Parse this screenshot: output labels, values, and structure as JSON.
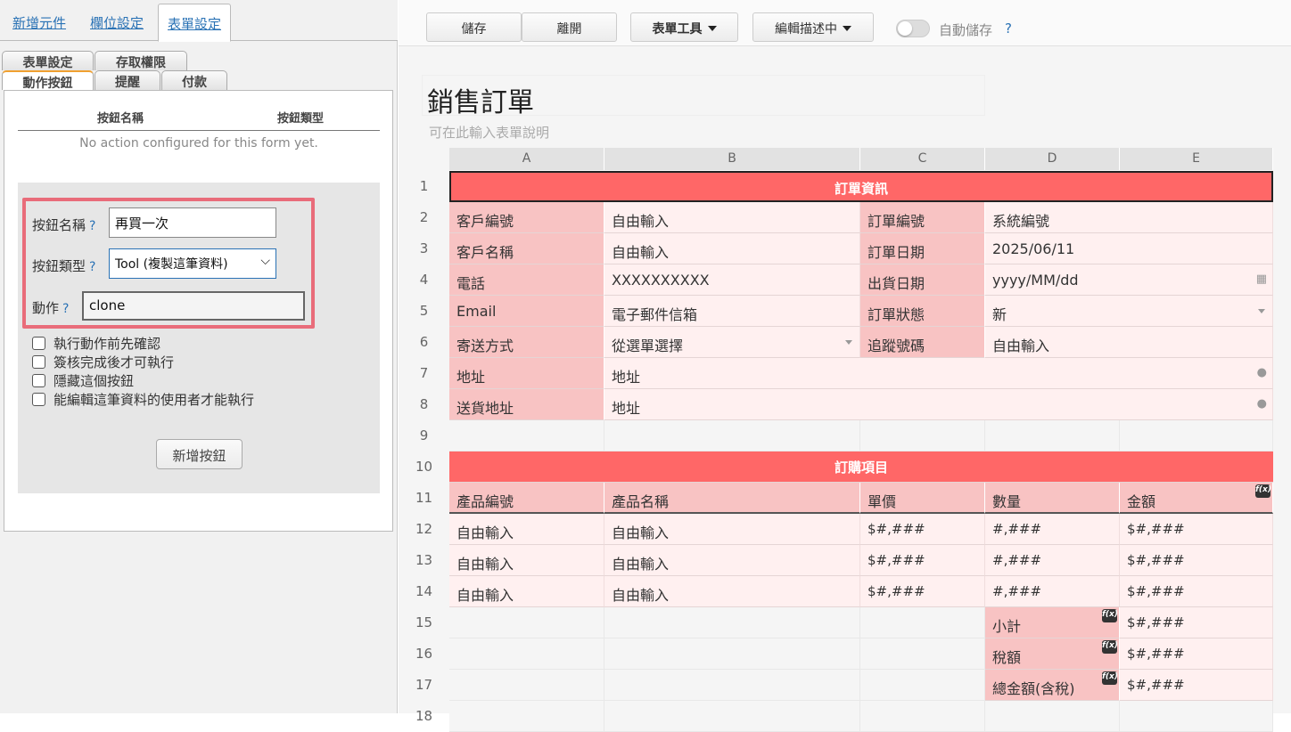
{
  "left_panel": {
    "top_tabs": [
      "新增元件",
      "欄位設定",
      "表單設定"
    ],
    "sub_tabs_row1": [
      "表單設定",
      "存取權限"
    ],
    "sub_tabs_row2": [
      "動作按鈕",
      "提醒",
      "付款"
    ],
    "table_headers": [
      "按鈕名稱",
      "按鈕類型"
    ],
    "empty_message": "No action configured for this form yet.",
    "form": {
      "name_label": "按鈕名稱",
      "name_value": "再買一次",
      "type_label": "按鈕類型",
      "type_value": "Tool (複製這筆資料)",
      "action_label": "動作",
      "action_value": "clone",
      "help": "?"
    },
    "checkboxes": [
      "執行動作前先確認",
      "簽核完成後才可執行",
      "隱藏這個按鈕",
      "能編輯這筆資料的使用者才能執行"
    ],
    "add_button": "新增按鈕"
  },
  "toolbar": {
    "save": "儲存",
    "leave": "離開",
    "form_tools": "表單工具",
    "edit_desc": "編輯描述中",
    "autosave": "自動儲存",
    "autosave_help": "?"
  },
  "form": {
    "title": "銷售訂單",
    "description": "可在此輸入表單說明"
  },
  "grid": {
    "columns": [
      "A",
      "B",
      "C",
      "D",
      "E"
    ],
    "rows": [
      "1",
      "2",
      "3",
      "4",
      "5",
      "6",
      "7",
      "8",
      "9",
      "10",
      "11",
      "12",
      "13",
      "14",
      "15",
      "16",
      "17",
      "18"
    ],
    "section1_title": "訂單資訊",
    "r2": [
      "客戶編號",
      "自由輸入",
      "訂單編號",
      "系統編號"
    ],
    "r3": [
      "客戶名稱",
      "自由輸入",
      "訂單日期",
      "2025/06/11"
    ],
    "r4": [
      "電話",
      "XXXXXXXXXX",
      "出貨日期",
      "yyyy/MM/dd"
    ],
    "r5": [
      "Email",
      "電子郵件信箱",
      "訂單狀態",
      "新"
    ],
    "r6": [
      "寄送方式",
      "從選單選擇",
      "追蹤號碼",
      "自由輸入"
    ],
    "r7": [
      "地址",
      "地址"
    ],
    "r8": [
      "送貨地址",
      "地址"
    ],
    "section2_title": "訂購項目",
    "r11": [
      "產品編號",
      "產品名稱",
      "單價",
      "數量",
      "金額"
    ],
    "item_row": [
      "自由輸入",
      "自由輸入",
      "$#,###",
      "#,###",
      "$#,###"
    ],
    "r15": [
      "小計",
      "$#,###"
    ],
    "r16": [
      "稅額",
      "$#,###"
    ],
    "r17": [
      "總金額(含稅)",
      "$#,###"
    ],
    "fx_label": "f(x)"
  },
  "colors": {
    "accent_red": "#ff6767",
    "label_pink": "#f8c3c3",
    "value_pink": "#fff0f0",
    "link_blue": "#2a72b5",
    "highlight_border": "#e96c7a"
  }
}
